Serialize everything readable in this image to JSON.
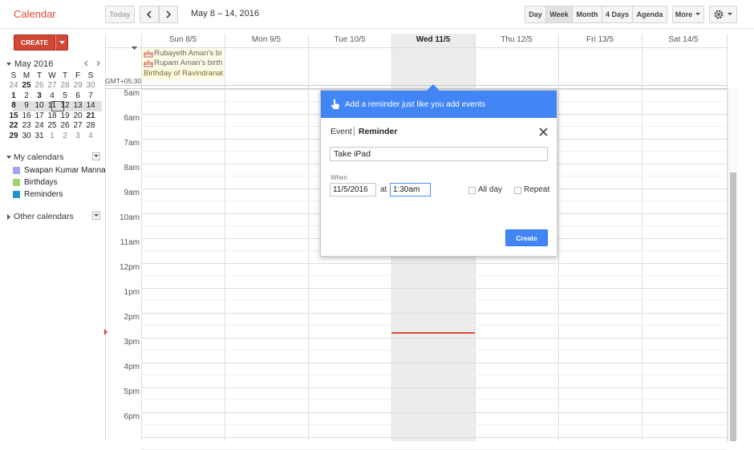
{
  "app_title": "Calendar",
  "toolbar": {
    "today_label": "Today",
    "date_range": "May 8 – 14, 2016",
    "views": [
      "Day",
      "Week",
      "Month",
      "4 Days",
      "Agenda"
    ],
    "selected_view": "Week",
    "more_label": "More"
  },
  "create_label": "CREATE",
  "mini_calendar": {
    "month_label": "May 2016",
    "weekday_headers": [
      "S",
      "M",
      "T",
      "W",
      "T",
      "F",
      "S"
    ],
    "weeks": [
      [
        "24",
        "25",
        "26",
        "27",
        "28",
        "29",
        "30"
      ],
      [
        "1",
        "2",
        "3",
        "4",
        "5",
        "6",
        "7"
      ],
      [
        "8",
        "9",
        "10",
        "11",
        "12",
        "13",
        "14"
      ],
      [
        "15",
        "16",
        "17",
        "18",
        "19",
        "20",
        "21"
      ],
      [
        "22",
        "23",
        "24",
        "25",
        "26",
        "27",
        "28"
      ],
      [
        "29",
        "30",
        "31",
        "1",
        "2",
        "3",
        "4"
      ]
    ],
    "today": "11"
  },
  "my_calendars": {
    "label": "My calendars",
    "items": [
      {
        "label": "Swapan Kumar Manna",
        "color": "#a4a4ef"
      },
      {
        "label": "Birthdays",
        "color": "#9fd26f"
      },
      {
        "label": "Reminders",
        "color": "#1f93d0"
      }
    ]
  },
  "other_calendars_label": "Other calendars",
  "timezone_label": "GMT+05:30",
  "week_days": [
    "Sun 8/5",
    "Mon 9/5",
    "Tue 10/5",
    "Wed 11/5",
    "Thu 12/5",
    "Fri 13/5",
    "Sat 14/5"
  ],
  "today_column": "Wed 11/5",
  "all_day_events": [
    "Rubayeth Aman's bi",
    "Rupam Aman's birth",
    "Birthday of Ravindranat"
  ],
  "hours": [
    "5am",
    "6am",
    "7am",
    "8am",
    "9am",
    "10am",
    "11am",
    "12pm",
    "1pm",
    "2pm",
    "3pm",
    "4pm",
    "5pm",
    "6pm"
  ],
  "popup": {
    "banner": "Add a reminder just like you add events",
    "tab_event": "Event",
    "tab_reminder": "Reminder",
    "title_value": "Take iPad",
    "when_label": "When",
    "date_value": "11/5/2016",
    "at_label": "at",
    "time_value": "1:30am",
    "all_day_label": "All day",
    "repeat_label": "Repeat",
    "create_label": "Create"
  },
  "colors": {
    "brand_red": "#d23f31",
    "popup_blue": "#4285f4",
    "now_line": "#dd4b39"
  }
}
